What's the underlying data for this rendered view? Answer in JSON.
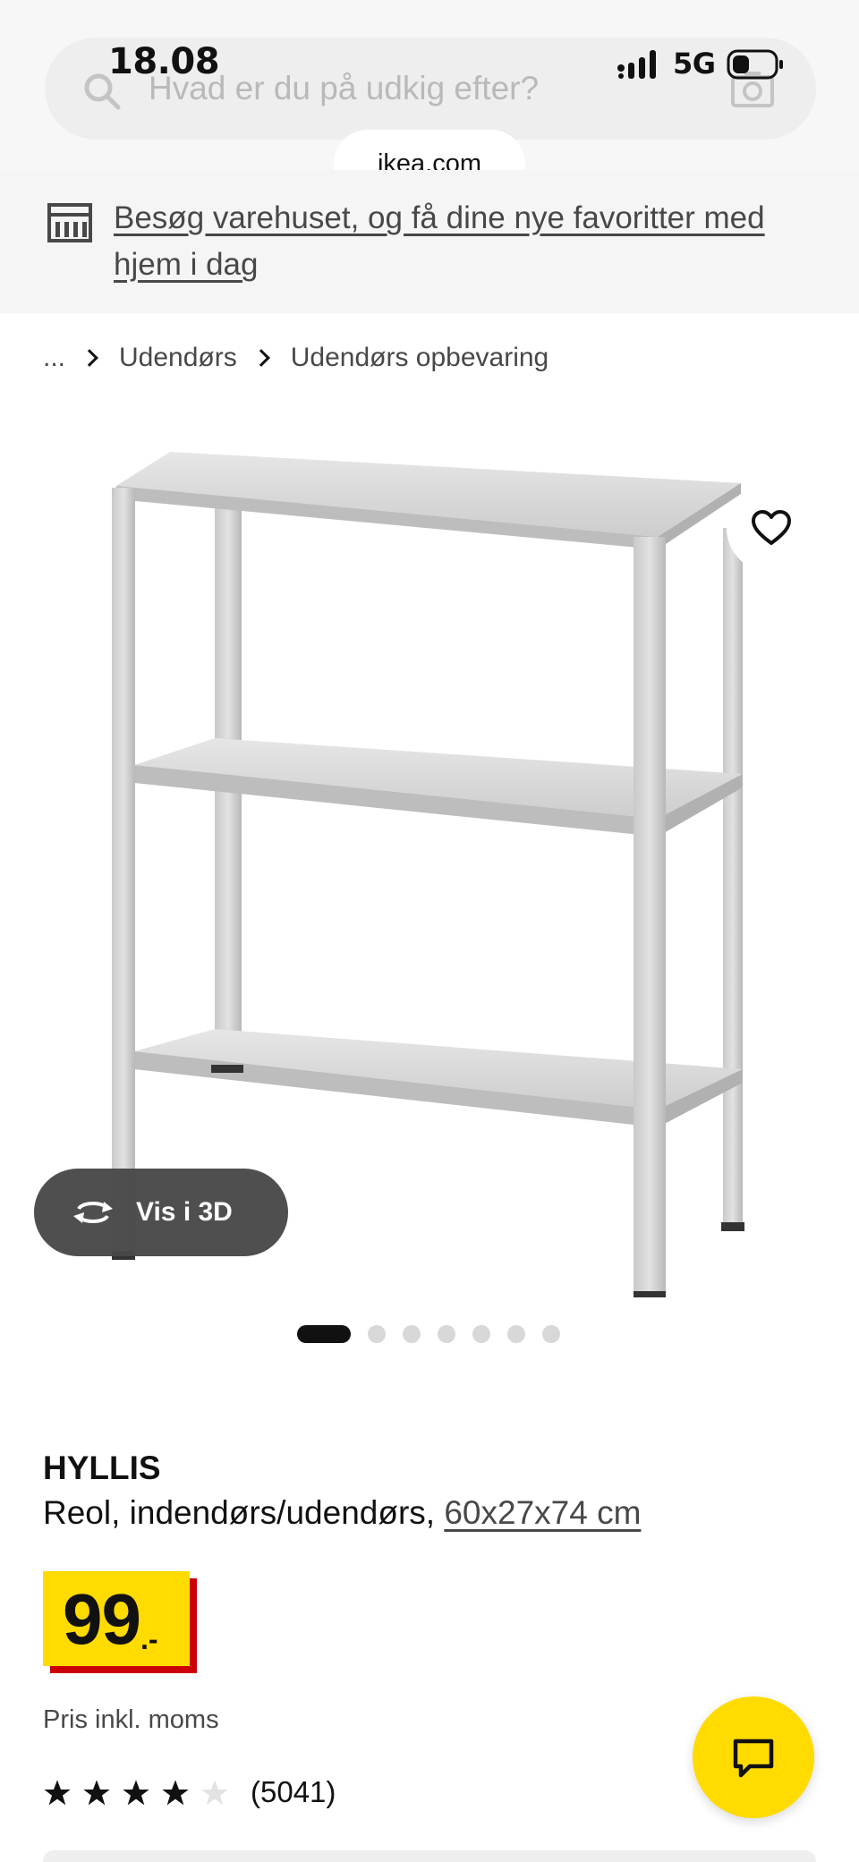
{
  "status_bar": {
    "time": "18.08",
    "network": "5G"
  },
  "search": {
    "placeholder": "Hvad er du på udkig efter?",
    "url": "ikea.com"
  },
  "banner": {
    "text": "Besøg varehuset, og få dine nye favoritter med hjem i dag"
  },
  "breadcrumb": {
    "ellipsis": "...",
    "items": [
      "Udendørs",
      "Udendørs opbevaring"
    ]
  },
  "gallery": {
    "view_3d_label": "Vis i 3D",
    "image_count": 7,
    "active_index": 0
  },
  "product": {
    "name": "HYLLIS",
    "description": "Reol, indendørs/udendørs,",
    "dimensions": "60x27x74 cm",
    "price_integer": "99",
    "price_suffix": ".-",
    "tax_note": "Pris inkl. moms",
    "rating": 4,
    "rating_max": 5,
    "review_count": "(5041)"
  },
  "colors": {
    "brand_yellow": "#ffdb00",
    "price_shadow_red": "#cc0008",
    "text": "#111111",
    "muted": "#484848"
  },
  "icons": [
    "search-icon",
    "camera-icon",
    "store-icon",
    "chevron-right-icon",
    "heart-icon",
    "rotate-3d-icon",
    "star-icon",
    "chat-icon",
    "battery-icon",
    "signal-icon"
  ]
}
